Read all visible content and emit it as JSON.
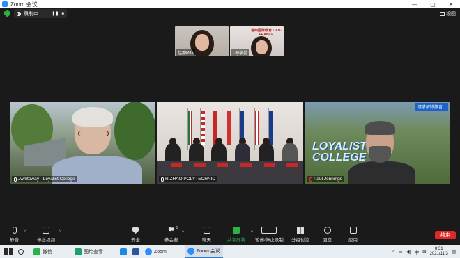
{
  "window": {
    "title": "Zoom 会议",
    "controls": [
      "—",
      "▢",
      "✕"
    ]
  },
  "meeting": {
    "recording_label": "录制中...",
    "view_label": "视图"
  },
  "thumbnails": [
    {
      "name": "赵静Rita"
    },
    {
      "name": "Lily李蕊"
    }
  ],
  "thumbnail_banner": "常州国际教育 CAN-FRANCE",
  "tiles": [
    {
      "name": "Jwhiteway - Loyalist College"
    },
    {
      "name": "RIZHAO POLYTECHNIC"
    },
    {
      "name": "Paul Jennings",
      "overlay_text": "LOYALIST COLLEGE",
      "badge": "请求解除静音..."
    }
  ],
  "controls": {
    "mute": "静音",
    "stop_video": "停止视频",
    "security": "安全",
    "participants": "参会者",
    "participants_count": "5",
    "chat": "聊天",
    "share_screen": "共享屏幕",
    "record": "暂停/停止录制",
    "breakout": "分组讨论",
    "reactions": "回应",
    "apps": "应用",
    "end": "结束"
  },
  "taskbar": {
    "items": [
      {
        "label": "微信",
        "color": "#2bb24c"
      },
      {
        "label": "图片查看",
        "color": "#1a9f6e"
      },
      {
        "label": "",
        "color": "#1e88e5"
      },
      {
        "label": "",
        "color": "#2b579a"
      },
      {
        "label": "Zoom",
        "color": "#2d8cff"
      },
      {
        "label": "Zoom 会议",
        "color": "#2d8cff"
      }
    ],
    "ime": "中",
    "time": "8:31",
    "date": "2021/11/3"
  }
}
